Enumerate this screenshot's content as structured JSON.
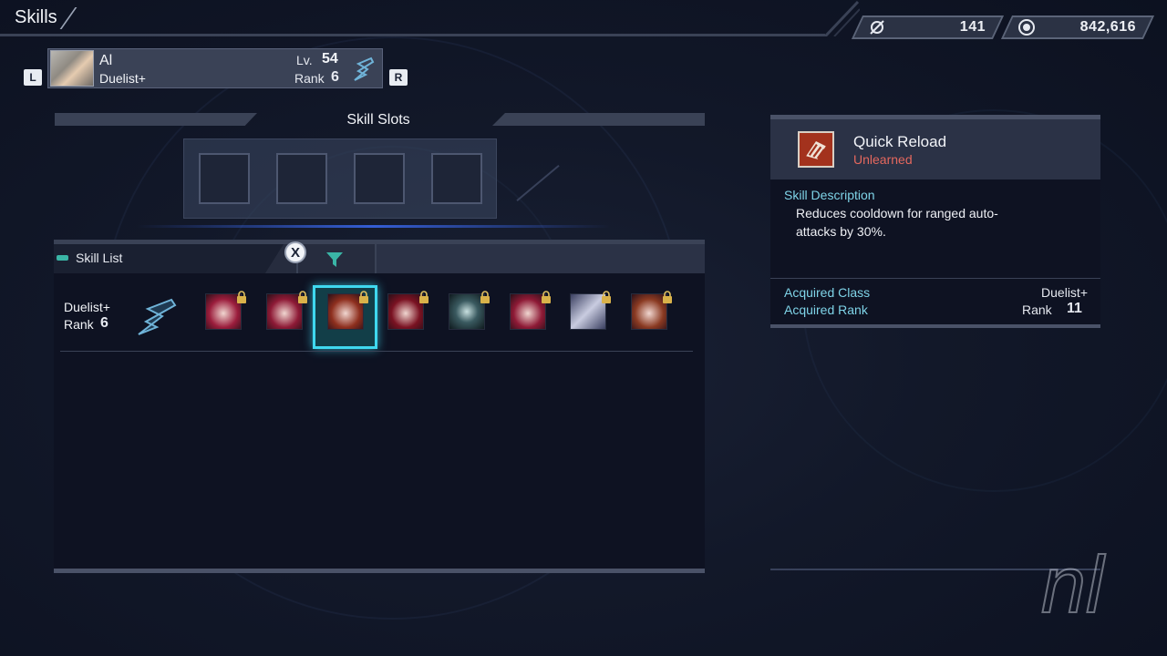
{
  "header": {
    "title": "Skills",
    "currency1": {
      "icon": "compass-icon",
      "value": "141"
    },
    "currency2": {
      "icon": "coin-icon",
      "value": "842,616"
    }
  },
  "character": {
    "name": "Al",
    "class": "Duelist+",
    "level_label": "Lv.",
    "level": "54",
    "rank_label": "Rank",
    "rank": "6",
    "prev_button": "L",
    "next_button": "R"
  },
  "skill_slots": {
    "title": "Skill Slots",
    "slots": [
      "",
      "",
      "",
      ""
    ]
  },
  "skill_list": {
    "title": "Skill List",
    "close_button": "X",
    "filter_icon": "filter-icon",
    "row": {
      "class": "Duelist+",
      "rank_label": "Rank",
      "rank": "6"
    },
    "skills": [
      {
        "icon": "torso-skill-icon",
        "locked": true,
        "color": "#9b1d3c"
      },
      {
        "icon": "arm-skill-icon",
        "locked": true,
        "color": "#8e1a36"
      },
      {
        "icon": "quick-reload-icon",
        "locked": true,
        "color": "#8e2f1e",
        "selected": true
      },
      {
        "icon": "claw-skill-icon",
        "locked": true,
        "color": "#7a1222"
      },
      {
        "icon": "fist-skill-icon",
        "locked": true,
        "color": "#1f3a3e"
      },
      {
        "icon": "shoulder-skill-icon",
        "locked": true,
        "color": "#8e1a36"
      },
      {
        "icon": "sword-skill-icon",
        "locked": true,
        "color": "#3e3a5a"
      },
      {
        "icon": "group-skill-icon",
        "locked": true,
        "color": "#8a3a22"
      }
    ]
  },
  "detail": {
    "skill_name": "Quick Reload",
    "status": "Unlearned",
    "description_label": "Skill Description",
    "description": "Reduces cooldown for ranged auto-attacks by 30%.",
    "acquired_class_label": "Acquired Class",
    "acquired_class": "Duelist+",
    "acquired_rank_label": "Acquired Rank",
    "acquired_rank_prefix": "Rank",
    "acquired_rank": "11"
  },
  "watermark": "nl"
}
